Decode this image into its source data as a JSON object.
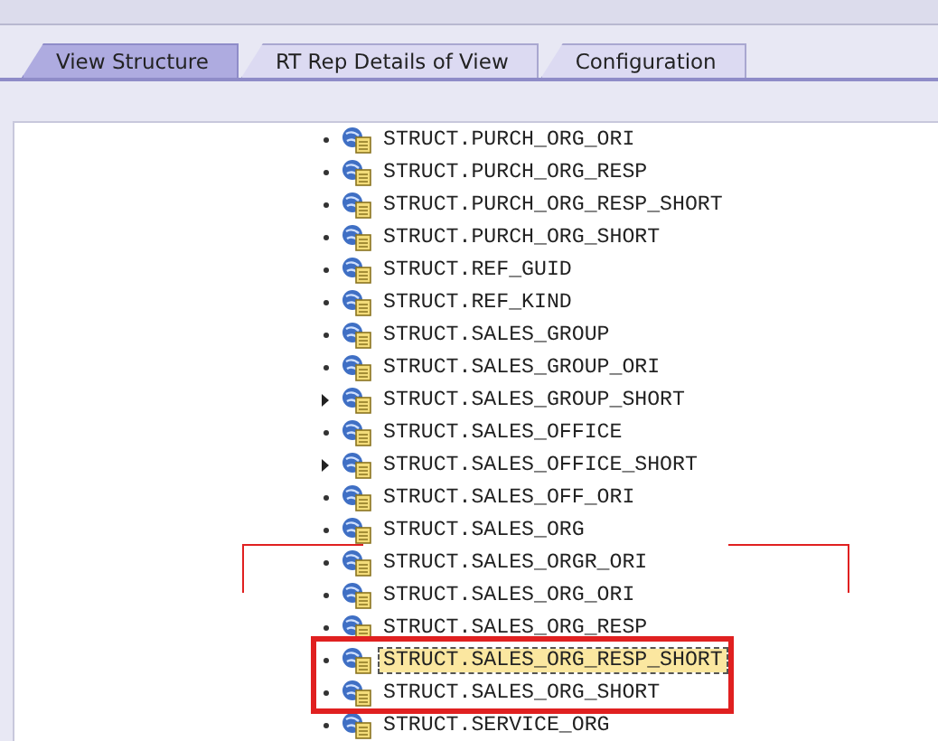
{
  "tabs": [
    {
      "label": "View Structure",
      "selected": true
    },
    {
      "label": "RT Rep Details of View",
      "selected": false
    },
    {
      "label": "Configuration",
      "selected": false
    }
  ],
  "tree": {
    "items": [
      {
        "label": "STRUCT.PURCH_ORG_ORI",
        "kind": "leaf",
        "selected": false,
        "boxed": false
      },
      {
        "label": "STRUCT.PURCH_ORG_RESP",
        "kind": "leaf",
        "selected": false,
        "boxed": false
      },
      {
        "label": "STRUCT.PURCH_ORG_RESP_SHORT",
        "kind": "leaf",
        "selected": false,
        "boxed": false
      },
      {
        "label": "STRUCT.PURCH_ORG_SHORT",
        "kind": "leaf",
        "selected": false,
        "boxed": false
      },
      {
        "label": "STRUCT.REF_GUID",
        "kind": "leaf",
        "selected": false,
        "boxed": false
      },
      {
        "label": "STRUCT.REF_KIND",
        "kind": "leaf",
        "selected": false,
        "boxed": false
      },
      {
        "label": "STRUCT.SALES_GROUP",
        "kind": "leaf",
        "selected": false,
        "boxed": false
      },
      {
        "label": "STRUCT.SALES_GROUP_ORI",
        "kind": "leaf",
        "selected": false,
        "boxed": false
      },
      {
        "label": "STRUCT.SALES_GROUP_SHORT",
        "kind": "expandable",
        "selected": false,
        "boxed": false
      },
      {
        "label": "STRUCT.SALES_OFFICE",
        "kind": "leaf",
        "selected": false,
        "boxed": false
      },
      {
        "label": "STRUCT.SALES_OFFICE_SHORT",
        "kind": "expandable",
        "selected": false,
        "boxed": false
      },
      {
        "label": "STRUCT.SALES_OFF_ORI",
        "kind": "leaf",
        "selected": false,
        "boxed": false
      },
      {
        "label": "STRUCT.SALES_ORG",
        "kind": "leaf",
        "selected": false,
        "boxed": false
      },
      {
        "label": "STRUCT.SALES_ORGR_ORI",
        "kind": "leaf",
        "selected": false,
        "boxed": false
      },
      {
        "label": "STRUCT.SALES_ORG_ORI",
        "kind": "leaf",
        "selected": false,
        "boxed": false
      },
      {
        "label": "STRUCT.SALES_ORG_RESP",
        "kind": "leaf",
        "selected": false,
        "boxed": false
      },
      {
        "label": "STRUCT.SALES_ORG_RESP_SHORT",
        "kind": "leaf",
        "selected": true,
        "boxed": true
      },
      {
        "label": "STRUCT.SALES_ORG_SHORT",
        "kind": "leaf",
        "selected": false,
        "boxed": true
      },
      {
        "label": "STRUCT.SERVICE_ORG",
        "kind": "leaf",
        "selected": false,
        "boxed": false
      }
    ]
  }
}
